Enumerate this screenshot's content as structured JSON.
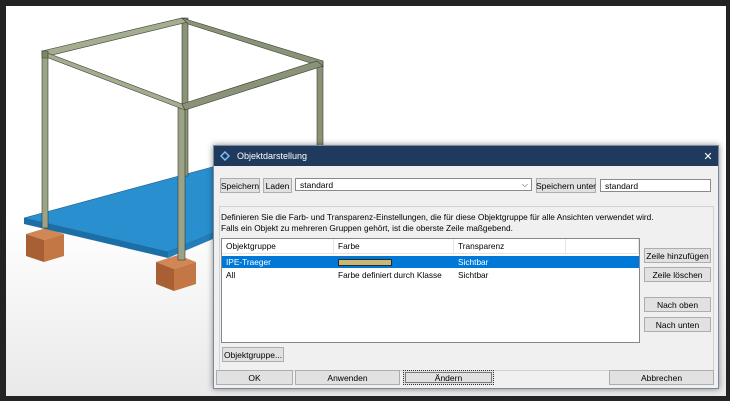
{
  "dialog": {
    "title": "Objektdarstellung",
    "toolbar": {
      "save": "Speichern",
      "load": "Laden",
      "combo_value": "standard",
      "save_as": "Speichern unter",
      "save_as_value": "standard"
    },
    "description": [
      "Definieren Sie die Farb- und Transparenz-Einstellungen, die für diese Objektgruppe für alle Ansichten verwendet wird.",
      "Falls ein Objekt zu mehreren Gruppen gehört, ist die oberste Zeile maßgebend."
    ],
    "table": {
      "columns": [
        "Objektgruppe",
        "Farbe",
        "Transparenz"
      ],
      "rows": [
        {
          "group": "IPE-Traeger",
          "color": "",
          "color_swatch": "#c8b877",
          "transparency": "Sichtbar",
          "selected": true
        },
        {
          "group": "All",
          "color": "Farbe definiert durch Klasse",
          "transparency": "Sichtbar",
          "selected": false
        }
      ]
    },
    "side_buttons": {
      "add_row": "Zeile hinzufügen",
      "delete_row": "Zeile löschen",
      "move_up": "Nach oben",
      "move_down": "Nach unten"
    },
    "object_group_button": "Objektgruppe...",
    "footer": {
      "ok": "OK",
      "apply": "Anwenden",
      "modify": "Ändern",
      "cancel": "Abbrechen"
    }
  },
  "colors": {
    "title_bar": "#1f3a5c",
    "slab": "#2a8fce",
    "beam": "#8a9378",
    "footing": "#b46a3e",
    "selection": "#0078d7"
  }
}
